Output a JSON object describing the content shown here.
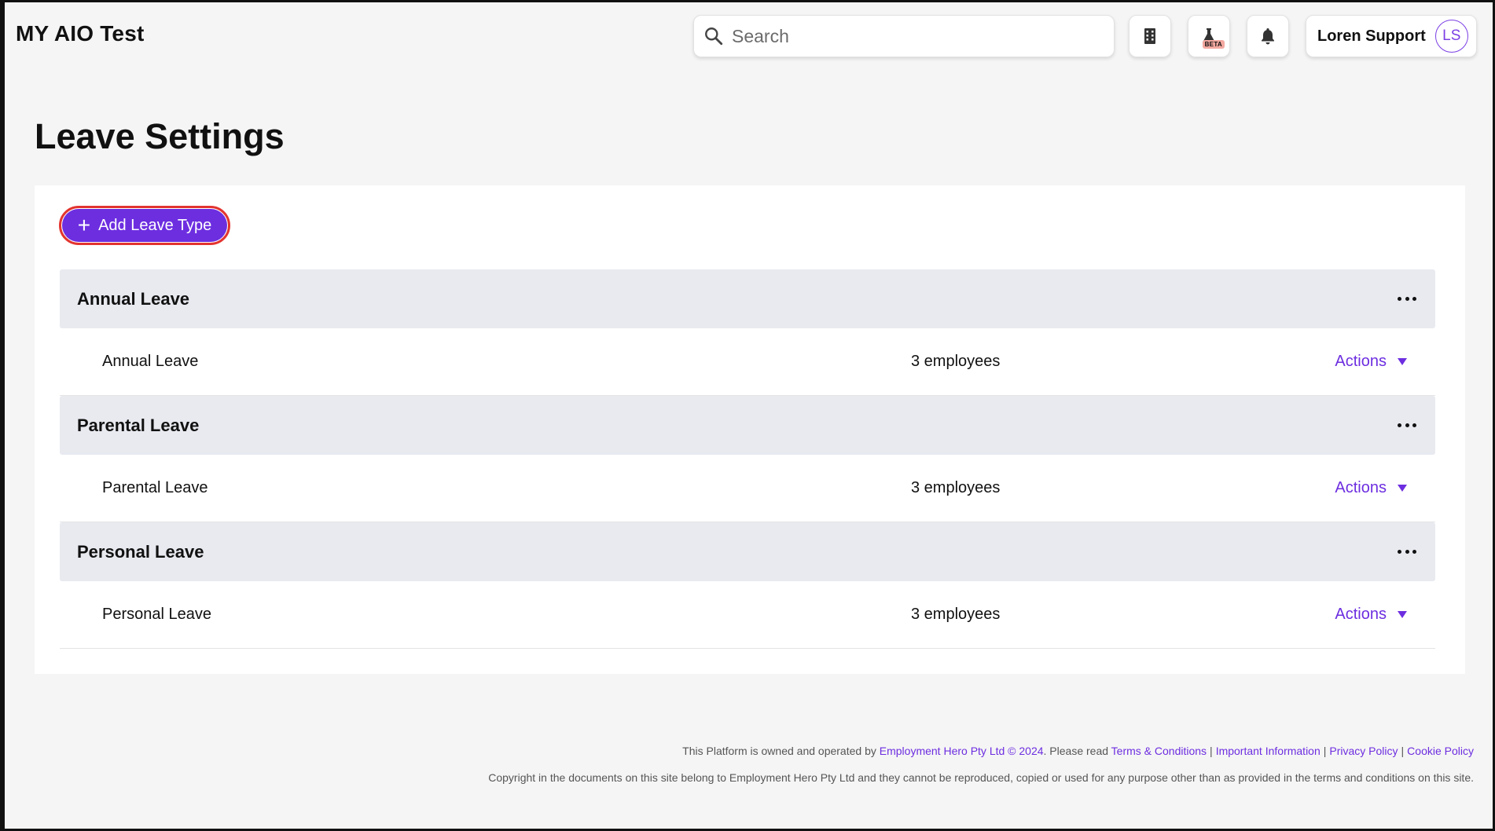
{
  "header": {
    "org_name": "MY AIO Test",
    "search_placeholder": "Search",
    "beta_badge": "BETA",
    "user_name": "Loren Support",
    "user_initials": "LS"
  },
  "page": {
    "title": "Leave Settings",
    "add_button_label": "Add Leave Type"
  },
  "groups": [
    {
      "title": "Annual Leave",
      "row_name": "Annual Leave",
      "row_count": "3 employees",
      "actions_label": "Actions"
    },
    {
      "title": "Parental Leave",
      "row_name": "Parental Leave",
      "row_count": "3 employees",
      "actions_label": "Actions"
    },
    {
      "title": "Personal Leave",
      "row_name": "Personal Leave",
      "row_count": "3 employees",
      "actions_label": "Actions"
    }
  ],
  "footer": {
    "line1_prefix": "This Platform is owned and operated by",
    "company_link": "Employment Hero Pty Ltd © 2024",
    "line1_mid": ". Please read",
    "terms_link": "Terms & Conditions",
    "important_link": "Important Information",
    "privacy_link": "Privacy Policy",
    "cookie_link": "Cookie Policy",
    "separator": "|",
    "line2": "Copyright in the documents on this site belong to Employment Hero Pty Ltd and they cannot be reproduced, copied or used for any purpose other than as provided in the terms and conditions on this site."
  },
  "colors": {
    "accent": "#6d2ee0",
    "highlight_outline": "#e3342f",
    "group_header_bg": "#e8eaf0",
    "page_bg": "#f5f5f5"
  }
}
